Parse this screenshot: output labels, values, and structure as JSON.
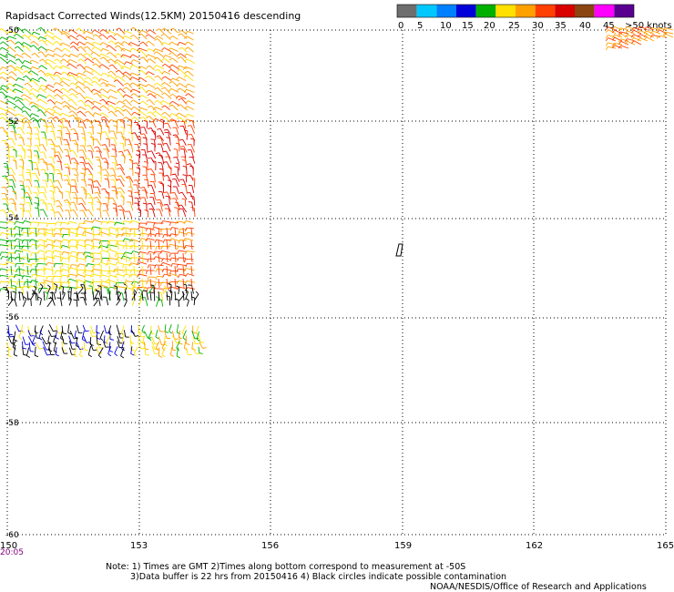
{
  "title": "Rapidsact Corrected Winds(12.5KM) 20150416 descending",
  "legend": {
    "labels": [
      "0",
      "5",
      "10",
      "15",
      "20",
      "25",
      "30",
      "35",
      "40",
      "45",
      ">50 knots"
    ],
    "colors": [
      "#6e6e6e",
      "#00c8ff",
      "#0080ff",
      "#0000d8",
      "#00b000",
      "#ffe000",
      "#ffa000",
      "#ff4000",
      "#d80000",
      "#8b4513",
      "#ff00ff",
      "#5a0090"
    ]
  },
  "latitude_labels": [
    "-50",
    "-52",
    "-54",
    "-56",
    "-58",
    "-60"
  ],
  "longitude_labels": [
    "150",
    "153",
    "156",
    "159",
    "162",
    "165"
  ],
  "time_label": "20:05",
  "notes": [
    "Note: 1) Times are GMT 2)Times along bottom correspond to measurement at -50S",
    "3)Data buffer is 22 hrs from 20150416 4) Black circles indicate possible contamination",
    "NOAA/NESDIS/Office of Research and Applications"
  ],
  "map_data": {
    "lon_range": [
      150,
      165
    ],
    "lat_range": [
      -60,
      -50
    ],
    "swaths": [
      {
        "name": "west-swath",
        "lon": [
          150,
          154.5
        ],
        "lat": [
          -55.9,
          -50
        ]
      },
      {
        "name": "west-swath-south-strip",
        "lon": [
          150,
          154.5
        ],
        "lat": [
          -56.7,
          -56.1
        ]
      },
      {
        "name": "northeast-corner",
        "lon": [
          164.2,
          165
        ],
        "lat": [
          -50.5,
          -50
        ]
      }
    ],
    "isolated_marker": {
      "lon": 158.9,
      "lat": -54.6
    }
  }
}
